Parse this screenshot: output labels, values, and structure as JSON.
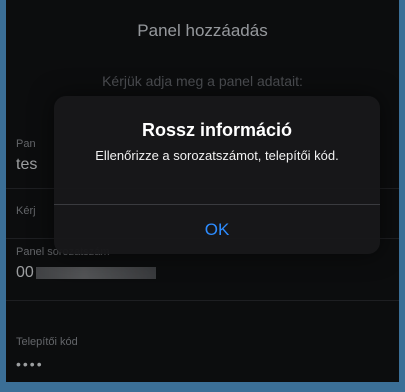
{
  "header": {
    "title": "Panel hozzáadás"
  },
  "form": {
    "instructions": "Kérjük adja meg a panel adatait:",
    "fields": [
      {
        "label": "Pan",
        "value": "tes"
      },
      {
        "label": "Kérj",
        "value": ""
      },
      {
        "label": "Panel sorozatszám",
        "value": "00"
      },
      {
        "label": "Telepítői kód",
        "value": "••••"
      }
    ]
  },
  "alert": {
    "title": "Rossz információ",
    "message": "Ellenőrizze a sorozatszámot, telepítői kód.",
    "ok_label": "OK"
  },
  "colors": {
    "accent": "#2d8cff",
    "frame": "#3b6f97",
    "background": "#111214"
  }
}
